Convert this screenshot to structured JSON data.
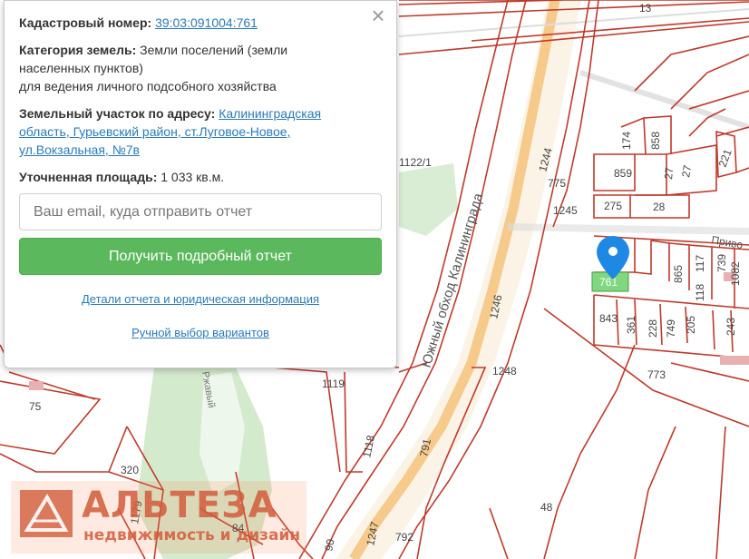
{
  "map": {
    "road_name": "Южный обход Калининграда",
    "street_label": "Приво",
    "selected_parcel": "761",
    "parcel_labels": [
      "13",
      "1122/1",
      "1244",
      "775",
      "1245",
      "859",
      "275",
      "28",
      "174",
      "858",
      "27",
      "221",
      "865",
      "117",
      "739",
      "1082",
      "118",
      "843",
      "361",
      "228",
      "749",
      "205",
      "243",
      "773",
      "1246",
      "1248",
      "1119",
      "791",
      "1118",
      "320",
      "48",
      "792",
      "1247",
      "90",
      "75",
      "84",
      "1179",
      "27"
    ],
    "stream_label": "Ржавый"
  },
  "popup": {
    "cadastral_label": "Кадастровый номер:",
    "cadastral_value": "39:03:091004:761",
    "category_label": "Категория земель:",
    "category_value": "Земли поселений (земли",
    "category_line2": "населенных пунктов)",
    "category_line3": "для ведения личного подсобного хозяйства",
    "address_label": "Земельный участок по адресу:",
    "address_line1": "Калининградская",
    "address_line2": "область, Гурьевский район, ст.Луговое-Новое,",
    "address_line3": "ул.Вокзальная, №7в",
    "area_label": "Уточненная площадь:",
    "area_value": "1 033 кв.м.",
    "email_placeholder": "Ваш email, куда отправить отчет",
    "report_button": "Получить подробный отчет",
    "details_link": "Детали отчета и юридическая информация",
    "manual_link": "Ручной выбор вариантов",
    "close_symbol": "×"
  },
  "watermark": {
    "name": "АЛЬТЕЗА",
    "subtitle": "недвижимость и дизайн"
  },
  "colors": {
    "parcel_line": "#c0392b",
    "road_fill": "#f5c27a",
    "selected_fill": "#7fd87f",
    "marker": "#1e88e5",
    "green_area": "#cfe8c8",
    "button": "#5cb85c",
    "link": "#2a7ab8"
  }
}
